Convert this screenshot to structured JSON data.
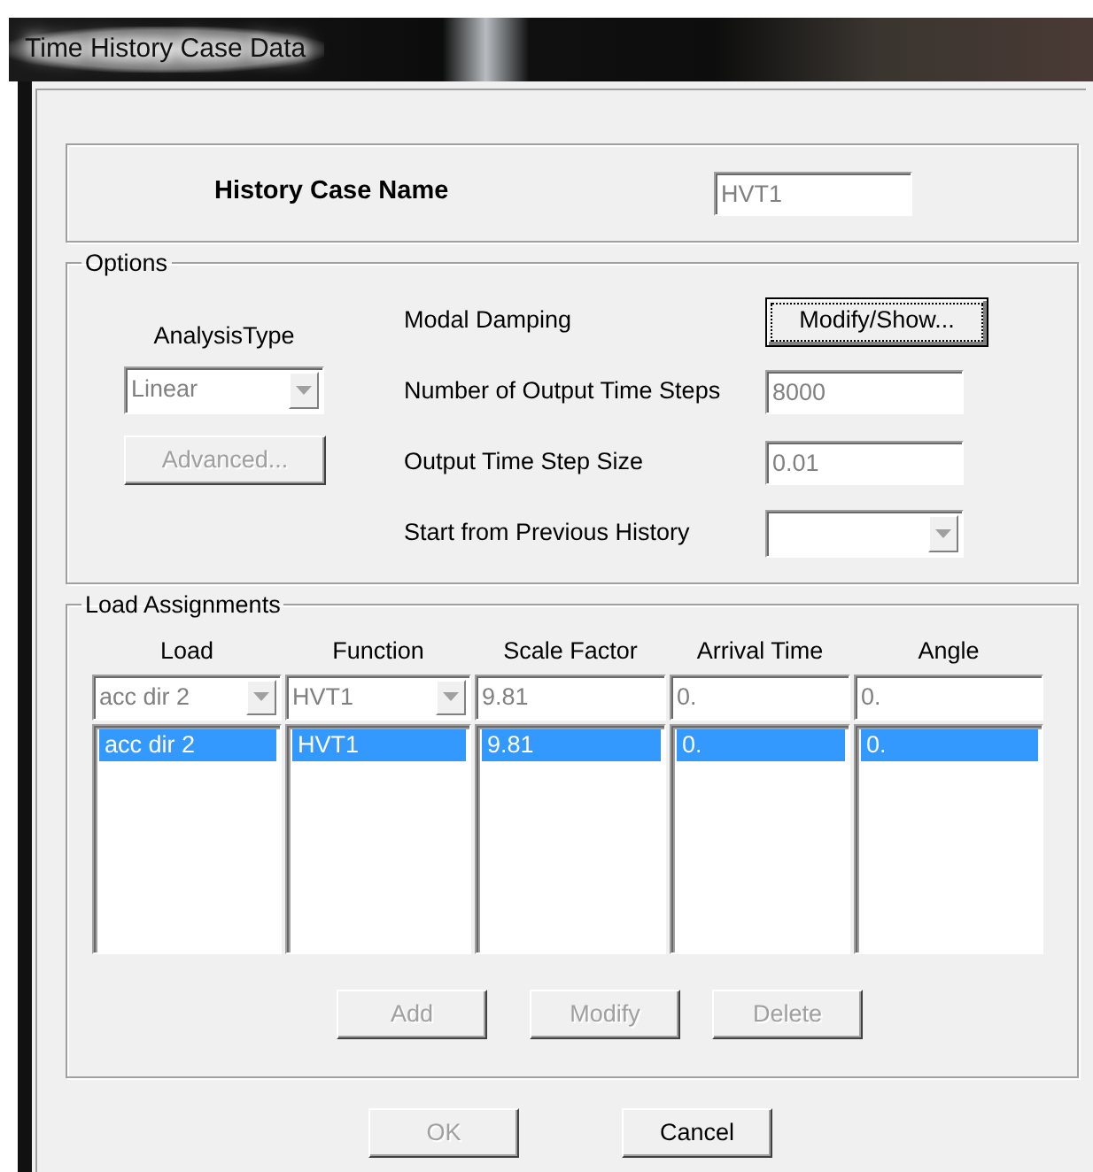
{
  "window": {
    "title": "Time History Case Data"
  },
  "history_case_name": {
    "label": "History Case Name",
    "value": "HVT1"
  },
  "options": {
    "legend": "Options",
    "analysis_type": {
      "label": "AnalysisType",
      "value": "Linear"
    },
    "advanced_button": {
      "label": "Advanced...",
      "disabled": true
    },
    "rows": [
      {
        "kind": "button",
        "label": "Modal Damping",
        "button": "Modify/Show...",
        "focused": true
      },
      {
        "kind": "field",
        "label": "Number of Output Time Steps",
        "value": "8000"
      },
      {
        "kind": "field",
        "label": "Output Time Step Size",
        "value": "0.01"
      },
      {
        "kind": "combo",
        "label": "Start from Previous History"
      }
    ]
  },
  "load_assignments": {
    "legend": "Load Assignments",
    "columns": [
      {
        "header": "Load",
        "input": {
          "kind": "combo",
          "value": "acc dir 2"
        }
      },
      {
        "header": "Function",
        "input": {
          "kind": "combo",
          "value": "HVT1"
        }
      },
      {
        "header": "Scale Factor",
        "input": {
          "kind": "field",
          "value": "9.81"
        }
      },
      {
        "header": "Arrival Time",
        "input": {
          "kind": "field",
          "value": "0."
        }
      },
      {
        "header": "Angle",
        "input": {
          "kind": "field",
          "value": "0."
        }
      }
    ],
    "rows": [
      {
        "cells": [
          "acc dir 2",
          "HVT1",
          "9.81",
          "0.",
          "0."
        ],
        "selected": true
      }
    ],
    "buttons": [
      {
        "label": "Add",
        "disabled": true
      },
      {
        "label": "Modify",
        "disabled": true
      },
      {
        "label": "Delete",
        "disabled": true
      }
    ]
  },
  "dialog_buttons": [
    {
      "label": "OK",
      "disabled": true
    },
    {
      "label": "Cancel",
      "disabled": false
    }
  ]
}
